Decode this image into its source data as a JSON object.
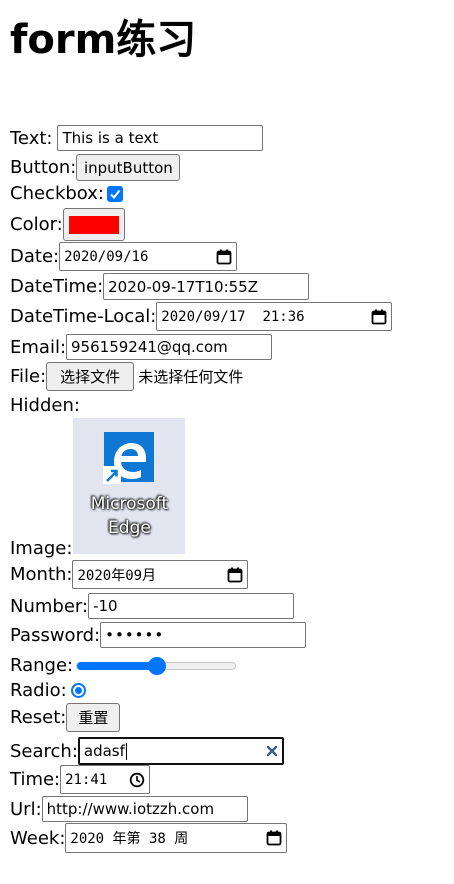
{
  "page": {
    "title": "form练习"
  },
  "form": {
    "text": {
      "label": "Text:",
      "value": "This is a text"
    },
    "button": {
      "label": "Button:",
      "button_text": "inputButton"
    },
    "checkbox": {
      "label": "Checkbox:",
      "checked": true
    },
    "color": {
      "label": "Color:",
      "value": "#ff0000"
    },
    "date": {
      "label": "Date:",
      "value": "2020/09/16",
      "icon": "calendar-icon"
    },
    "datetime": {
      "label": "DateTime:",
      "value": "2020-09-17T10:55Z"
    },
    "datetime_local": {
      "label": "DateTime-Local:",
      "value": "2020/09/17  21:36",
      "icon": "calendar-icon"
    },
    "email": {
      "label": "Email:",
      "value": "956159241@qq.com"
    },
    "file": {
      "label": "File:",
      "button_text": "选择文件",
      "status": "未选择任何文件"
    },
    "hidden": {
      "label": "Hidden:"
    },
    "image": {
      "label": "Image:",
      "caption_line1": "Microsoft",
      "caption_line2": "Edge",
      "icon": "edge-shortcut-icon"
    },
    "month": {
      "label": "Month:",
      "value": "2020年09月",
      "icon": "calendar-icon"
    },
    "number": {
      "label": "Number:",
      "value": "-10"
    },
    "password": {
      "label": "Password:",
      "value": "••••••"
    },
    "range": {
      "label": "Range:",
      "value_fraction": 0.5
    },
    "radio": {
      "label": "Radio:",
      "checked": true
    },
    "reset": {
      "label": "Reset:",
      "button_text": "重置"
    },
    "search": {
      "label": "Search:",
      "value": "adasf",
      "icon": "clear-icon"
    },
    "time": {
      "label": "Time:",
      "value": "21:41",
      "icon": "clock-icon"
    },
    "url": {
      "label": "Url:",
      "value": "http://www.iotzzh.com"
    },
    "week": {
      "label": "Week:",
      "value": "2020 年第 38 周",
      "icon": "calendar-icon"
    }
  },
  "colors": {
    "accent": "#0075ff",
    "swatch": "#ff0000",
    "edge_blue": "#0f78d4"
  }
}
